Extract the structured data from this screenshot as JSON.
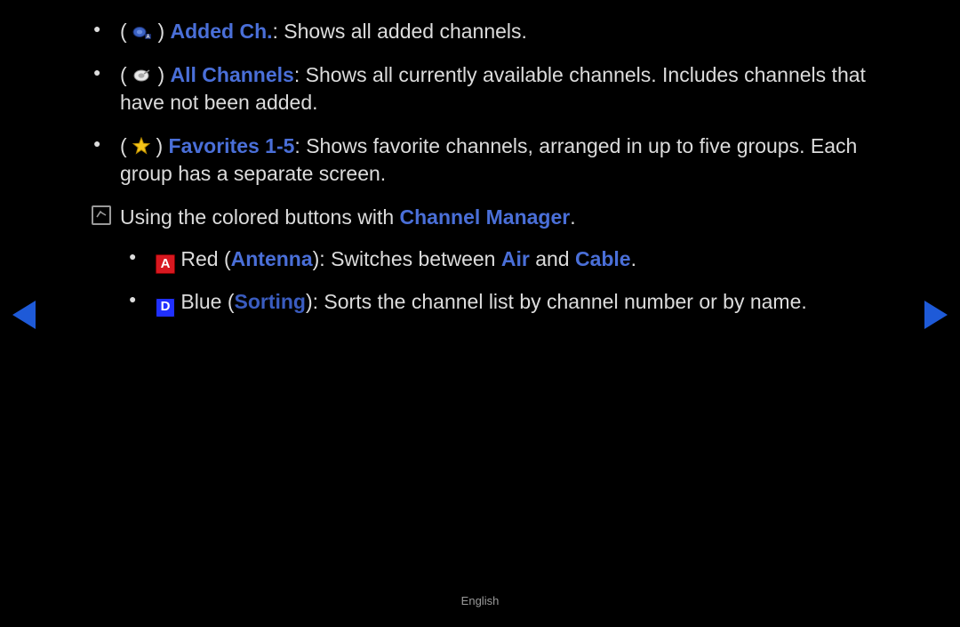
{
  "items": [
    {
      "term": "Added Ch.",
      "text": ": Shows all added channels."
    },
    {
      "term": "All Channels",
      "text": ": Shows all currently available channels. Includes channels that have not been added."
    },
    {
      "term": "Favorites 1-5",
      "text": ": Shows favorite channels, arranged in up to five groups. Each group has a separate screen."
    }
  ],
  "note": {
    "prefix": "Using the colored buttons with ",
    "link": "Channel Manager",
    "suffix": "."
  },
  "sub": [
    {
      "letter": "A",
      "t1": " Red (",
      "term1": "Antenna",
      "t2": "): Switches between ",
      "term2": "Air",
      "t3": " and ",
      "term3": "Cable",
      "t4": "."
    },
    {
      "letter": "D",
      "t1": " Blue (",
      "term1": "Sorting",
      "t2": "): Sorts the channel list by channel number or by name.",
      "term2": "",
      "t3": "",
      "term3": "",
      "t4": ""
    }
  ],
  "footer": {
    "lang": "English"
  }
}
